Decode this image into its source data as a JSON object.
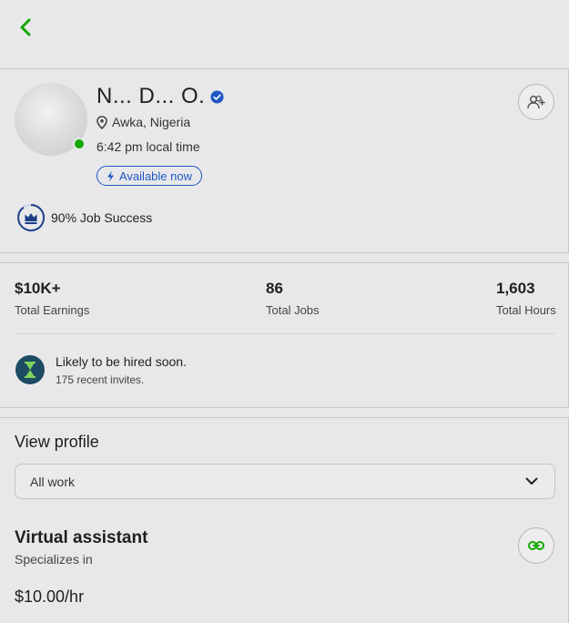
{
  "profile": {
    "name": "N... D... O.",
    "location": "Awka, Nigeria",
    "local_time": "6:42 pm local time",
    "availability": "Available now",
    "job_success": "90% Job Success"
  },
  "stats": {
    "earnings_value": "$10K+",
    "earnings_label": "Total Earnings",
    "jobs_value": "86",
    "jobs_label": "Total Jobs",
    "hours_value": "1,603",
    "hours_label": "Total Hours",
    "hire_title": "Likely to be hired soon.",
    "hire_sub": "175 recent invites."
  },
  "view": {
    "title": "View profile",
    "select_value": "All work",
    "specialty_title": "Virtual assistant",
    "specialty_sub": "Specializes in",
    "rate": "$10.00/hr"
  },
  "colors": {
    "accent_green": "#14a800",
    "link_blue": "#1f57c3",
    "side_tab_blue": "#1b76d2"
  },
  "icons": [
    "back-arrow-icon",
    "verified-badge-icon",
    "location-pin-icon",
    "lightning-icon",
    "add-user-icon",
    "crown-icon",
    "search-tab-icon",
    "hourglass-icon",
    "chevron-down-icon",
    "link-icon"
  ]
}
